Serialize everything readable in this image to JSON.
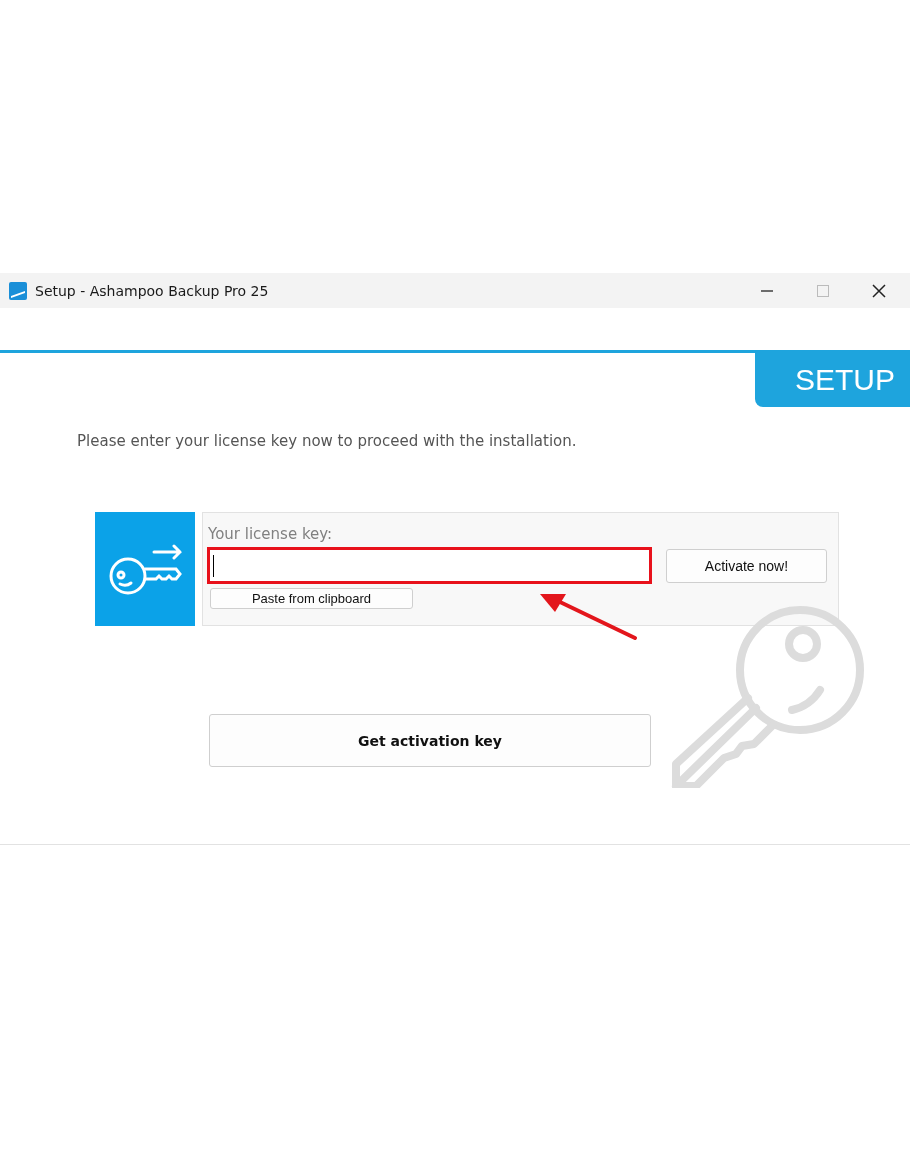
{
  "window": {
    "title": "Setup - Ashampoo Backup Pro 25"
  },
  "banner": {
    "label": "SETUP"
  },
  "instruction": "Please enter your license key now to proceed with the installation.",
  "license": {
    "label": "Your license key:",
    "focused": true,
    "buttons": [
      {
        "kind": "activate",
        "label": "Activate now!"
      },
      {
        "kind": "paste",
        "label": "Paste from clipboard"
      }
    ]
  },
  "primary_button": {
    "label": "Get activation key"
  }
}
